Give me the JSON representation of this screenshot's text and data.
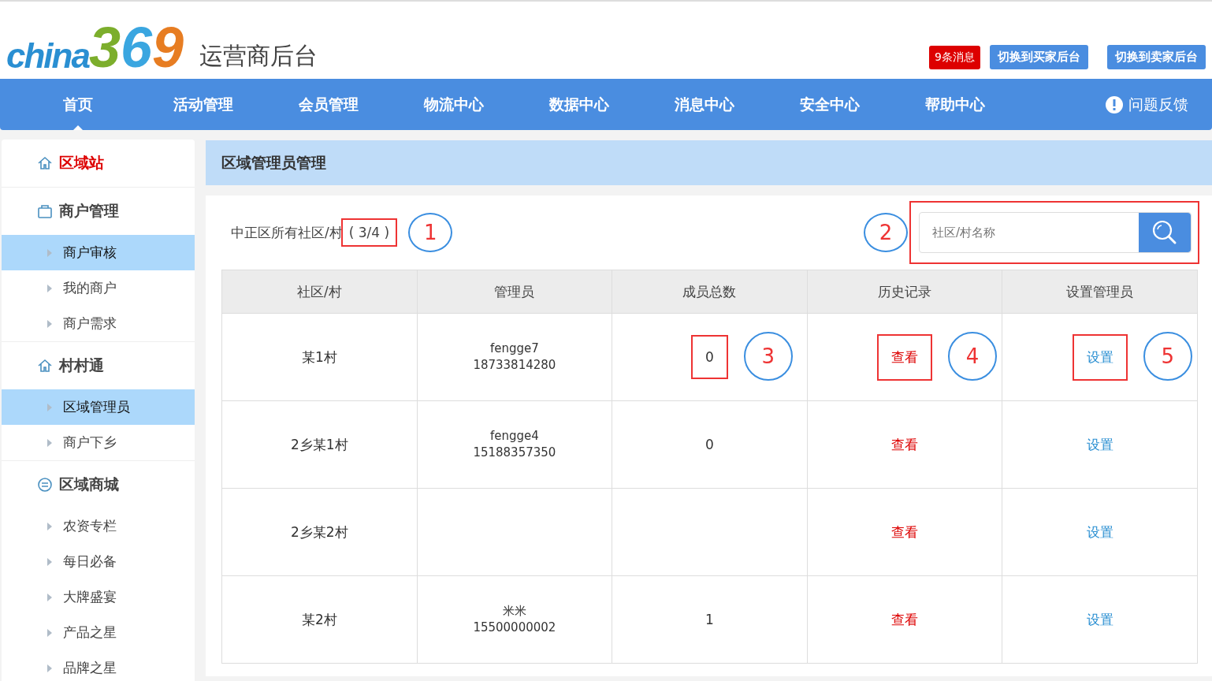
{
  "header": {
    "logo": {
      "word": "china",
      "digits": "369"
    },
    "title": "运营商后台",
    "messages": "9条消息",
    "buttons": [
      "切换到买家后台",
      "切换到卖家后台"
    ]
  },
  "nav": {
    "items": [
      {
        "label": "首页",
        "selected": true
      },
      {
        "label": "活动管理",
        "selected": false
      },
      {
        "label": "会员管理",
        "selected": false
      },
      {
        "label": "物流中心",
        "selected": false
      },
      {
        "label": "数据中心",
        "selected": false
      },
      {
        "label": "消息中心",
        "selected": false
      },
      {
        "label": "安全中心",
        "selected": false
      },
      {
        "label": "帮助中心",
        "selected": false
      }
    ],
    "feedback": "问题反馈"
  },
  "sidebar": {
    "groups": [
      {
        "title": "区域站",
        "active": true
      },
      {
        "title": "商户管理",
        "active": false,
        "items": [
          {
            "label": "商户审核",
            "selected": true
          },
          {
            "label": "我的商户",
            "selected": false
          },
          {
            "label": "商户需求",
            "selected": false
          }
        ]
      },
      {
        "title": "村村通",
        "active": false,
        "items": [
          {
            "label": "区域管理员",
            "selected": true
          },
          {
            "label": "商户下乡",
            "selected": false
          }
        ]
      },
      {
        "title": "区域商城",
        "active": false,
        "items": [
          {
            "label": "农资专栏",
            "selected": false
          },
          {
            "label": "每日必备",
            "selected": false
          },
          {
            "label": "大牌盛宴",
            "selected": false
          },
          {
            "label": "产品之星",
            "selected": false
          },
          {
            "label": "品牌之星",
            "selected": false
          }
        ]
      }
    ]
  },
  "main": {
    "title": "区域管理员管理",
    "summary": {
      "label": "中正区所有社区/村",
      "count": "( 3/4 )",
      "callout": "1"
    },
    "search": {
      "placeholder": "社区/村名称",
      "callout": "2"
    },
    "table": {
      "columns": [
        "社区/村",
        "管理员",
        "成员总数",
        "历史记录",
        "设置管理员"
      ],
      "rows": [
        [
          {
            "kind": "text",
            "text": "某1村"
          },
          {
            "kind": "admin",
            "lines": [
              "fengge7",
              "18733814280"
            ]
          },
          {
            "kind": "text",
            "text": "0",
            "callout": "3"
          },
          {
            "kind": "view",
            "text": "查看",
            "callout": "4"
          },
          {
            "kind": "set",
            "text": "设置",
            "callout": "5"
          }
        ],
        [
          {
            "kind": "text",
            "text": "2乡某1村"
          },
          {
            "kind": "admin",
            "lines": [
              "fengge4",
              "15188357350"
            ]
          },
          {
            "kind": "text",
            "text": "0"
          },
          {
            "kind": "view",
            "text": "查看"
          },
          {
            "kind": "set",
            "text": "设置"
          }
        ],
        [
          {
            "kind": "text",
            "text": "2乡某2村"
          },
          {
            "kind": "empty"
          },
          {
            "kind": "empty"
          },
          {
            "kind": "view",
            "text": "查看"
          },
          {
            "kind": "set",
            "text": "设置"
          }
        ],
        [
          {
            "kind": "text",
            "text": "某2村"
          },
          {
            "kind": "admin",
            "lines": [
              "米米",
              "15500000002"
            ]
          },
          {
            "kind": "text",
            "text": "1"
          },
          {
            "kind": "view",
            "text": "查看"
          },
          {
            "kind": "set",
            "text": "设置"
          }
        ]
      ]
    }
  }
}
